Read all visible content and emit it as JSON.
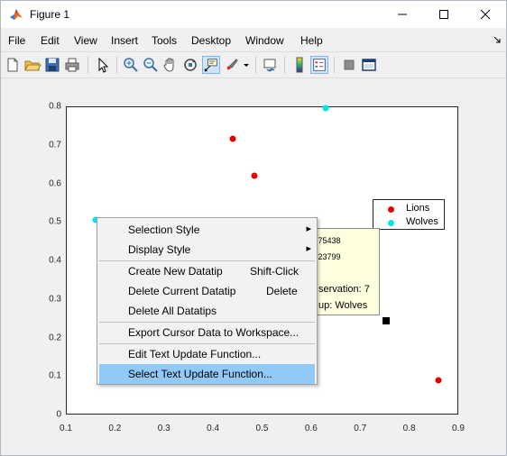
{
  "window": {
    "title": "Figure 1",
    "controls": [
      "minimize",
      "maximize",
      "close"
    ]
  },
  "menubar": [
    "File",
    "Edit",
    "View",
    "Insert",
    "Tools",
    "Desktop",
    "Window",
    "Help"
  ],
  "toolbar": {
    "buttons": [
      "new-figure-icon",
      "open-file-icon",
      "save-icon",
      "print-icon",
      "edit-plot-icon",
      "zoom-in-icon",
      "zoom-out-icon",
      "pan-icon",
      "rotate-3d-icon",
      "data-cursor-icon",
      "brush-icon",
      "link-plot-icon",
      "colorbar-icon",
      "legend-icon",
      "hide-plot-tools-icon",
      "show-plot-tools-icon"
    ],
    "active": "data-cursor-icon"
  },
  "chart_data": {
    "type": "scatter",
    "xlim": [
      0.1,
      0.9
    ],
    "ylim": [
      0,
      0.8
    ],
    "x_ticks": [
      "0.1",
      "0.2",
      "0.3",
      "0.4",
      "0.5",
      "0.6",
      "0.7",
      "0.8",
      "0.9"
    ],
    "y_ticks": [
      "0",
      "0.1",
      "0.2",
      "0.3",
      "0.4",
      "0.5",
      "0.6",
      "0.7",
      "0.8"
    ],
    "series": [
      {
        "name": "Lions",
        "color": "#e60000",
        "points": [
          [
            0.44,
            0.715
          ],
          [
            0.485,
            0.62
          ],
          [
            0.86,
            0.09
          ]
        ]
      },
      {
        "name": "Wolves",
        "color": "#00e6e6",
        "points": [
          [
            0.16,
            0.505
          ],
          [
            0.63,
            0.795
          ]
        ]
      }
    ],
    "legend_position": "right"
  },
  "datatip": {
    "lines": [
      ".75438",
      ".23799",
      "servation: 7",
      "up: Wolves"
    ]
  },
  "context_menu": {
    "items": [
      {
        "label": "Selection Style",
        "shortcut": "",
        "submenu": true
      },
      {
        "label": "Display Style",
        "shortcut": "",
        "submenu": true
      },
      {
        "label": "Create New Datatip",
        "shortcut": "Shift-Click",
        "submenu": false
      },
      {
        "label": "Delete Current Datatip",
        "shortcut": "Delete",
        "submenu": false
      },
      {
        "label": "Delete All Datatips",
        "shortcut": "",
        "submenu": false
      },
      {
        "label": "Export Cursor Data to Workspace...",
        "shortcut": "",
        "submenu": false
      },
      {
        "label": "Edit Text Update Function...",
        "shortcut": "",
        "submenu": false
      },
      {
        "label": "Select Text Update Function...",
        "shortcut": "",
        "submenu": false
      }
    ],
    "highlighted": "Select Text Update Function...",
    "submenu_arrow": "▸"
  }
}
